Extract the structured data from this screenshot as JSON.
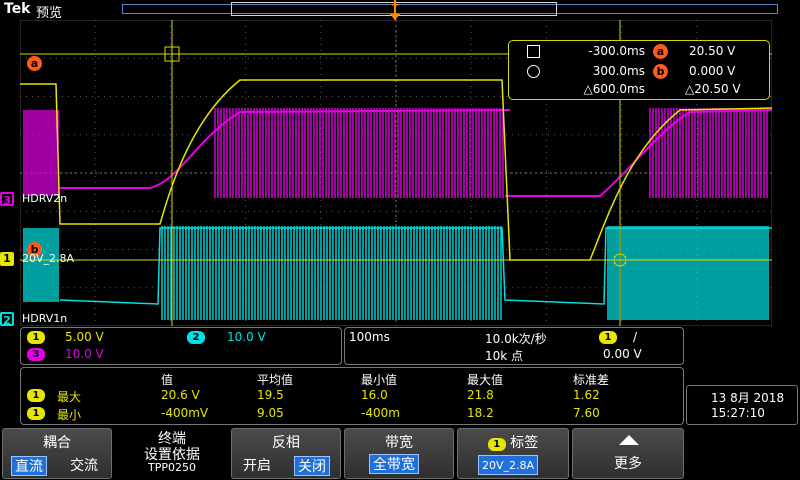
{
  "header": {
    "brand": "Tek",
    "mode": "预览"
  },
  "colors": {
    "ch1": "#e6e600",
    "ch2": "#00e1e1",
    "ch3": "#e600e6",
    "grid": "#5a5a5a",
    "menu_sel": "#1f70d8",
    "cursor_badge": "#ff5a1e"
  },
  "waveform_labels": {
    "ch3": "HDRV2n",
    "ch1": "20V_2.8A",
    "ch2": "HDRV1n",
    "cursor_a": "a",
    "cursor_b": "b"
  },
  "channel_markers": {
    "ch1": "1",
    "ch2": "2",
    "ch3": "3"
  },
  "cursor_readout": {
    "t1": "-300.0ms",
    "t2": "300.0ms",
    "dt": "△600.0ms",
    "a_val": "20.50 V",
    "b_val": "0.000 V",
    "dv": "△20.50 V",
    "a_label": "a",
    "b_label": "b"
  },
  "channel_info": {
    "ch1_num": "1",
    "ch1_scale": "5.00 V",
    "ch2_num": "2",
    "ch2_scale": "10.0 V",
    "ch3_num": "3",
    "ch3_scale": "10.0 V"
  },
  "timebase": {
    "scale": "100ms",
    "sample_rate": "10.0k次/秒",
    "record": "10k 点",
    "trig_src": "1",
    "trig_slope": "/",
    "trig_level": "0.00 V"
  },
  "measurements": {
    "headers": [
      "值",
      "平均值",
      "最小值",
      "最大值",
      "标准差"
    ],
    "rows": [
      {
        "ch": "1",
        "name": "最大",
        "values": [
          "20.6 V",
          "19.5",
          "16.0",
          "21.8",
          "1.62"
        ]
      },
      {
        "ch": "1",
        "name": "最小",
        "values": [
          "-400mV",
          "9.05",
          "-400m",
          "18.2",
          "7.60"
        ]
      }
    ]
  },
  "datetime": {
    "date": "13 8月 2018",
    "time": "15:27:10"
  },
  "menu": {
    "coupling": {
      "title": "耦合",
      "opt1": "直流",
      "opt2": "交流"
    },
    "termination": {
      "line1": "终端",
      "line2": "设置依据",
      "line3": "TPP0250"
    },
    "invert": {
      "title": "反相",
      "opt1": "开启",
      "opt2": "关闭"
    },
    "bandwidth": {
      "title": "带宽",
      "value": "全带宽"
    },
    "label": {
      "badge": "1",
      "title": "标签",
      "value": "20V_2.8A"
    },
    "more": {
      "title": "更多"
    }
  }
}
